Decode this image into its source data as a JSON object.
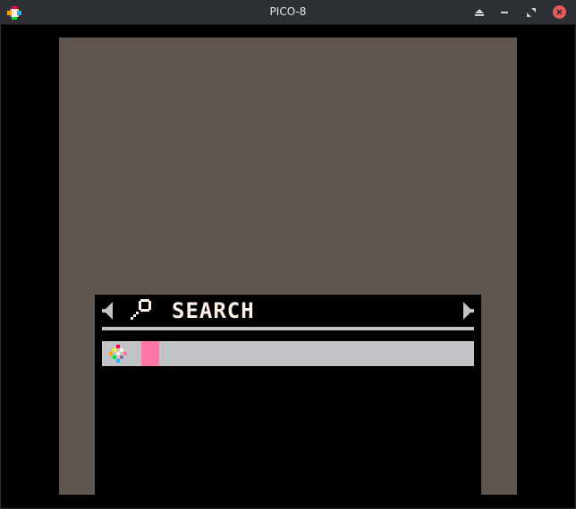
{
  "window": {
    "title": "PICO-8",
    "controls": [
      "eject-icon",
      "minimize-icon",
      "maximize-icon",
      "close-icon"
    ],
    "close_color": "#e35b5b",
    "titlebar_color": "#2c2f33"
  },
  "app": {
    "screen_bg": "#5f574f",
    "panel_bg": "#000000",
    "header": {
      "label": "SEARCH",
      "left_arrow": "arrow-left-icon",
      "right_arrow": "arrow-right-icon",
      "icon": "magnifier-icon"
    },
    "search": {
      "value": "",
      "field_bg": "#c2c3c7",
      "cursor_color": "#ff77a8",
      "icon": "pico8-logo-icon"
    }
  }
}
